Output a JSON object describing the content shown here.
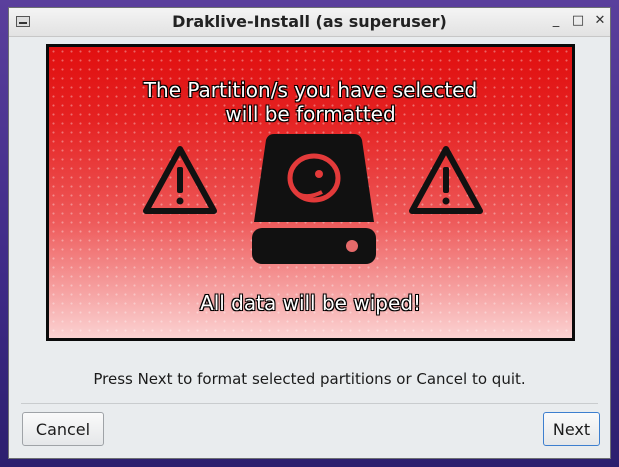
{
  "window": {
    "title": "Draklive-Install (as superuser)",
    "controls": [
      "_",
      "□",
      "✕"
    ]
  },
  "banner": {
    "line1": "The Partition/s you have selected",
    "line2": "will be formatted",
    "bottom": "All data will be wiped!",
    "icons": [
      "warning-icon",
      "hard-drive-icon",
      "warning-icon"
    ]
  },
  "message": "Press Next to format selected partitions or Cancel to quit.",
  "buttons": {
    "cancel": "Cancel",
    "next": "Next"
  },
  "colors": {
    "banner_top": "#e11010",
    "banner_bottom": "#fbd2d2",
    "next_border": "#3d7fcf"
  }
}
